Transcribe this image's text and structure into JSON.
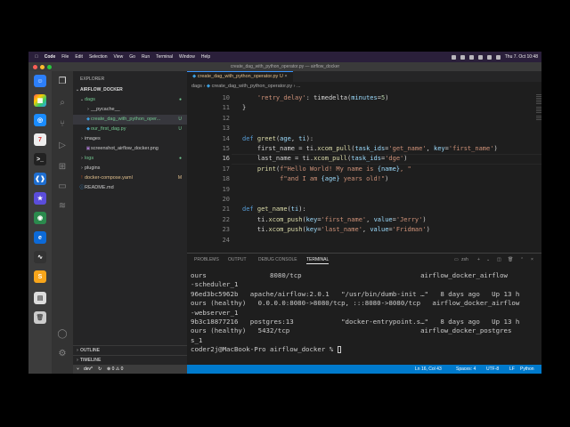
{
  "menubar": {
    "apple": "",
    "app": "Code",
    "items": [
      "File",
      "Edit",
      "Selection",
      "View",
      "Go",
      "Run",
      "Terminal",
      "Window",
      "Help"
    ],
    "clock": "Thu 7. Oct 10:48"
  },
  "window": {
    "title": "create_dag_with_python_operator.py — airflow_docker"
  },
  "sidebar": {
    "title": "EXPLORER",
    "root": "AIRFLOW_DOCKER",
    "items": [
      {
        "label": "dags",
        "type": "folder",
        "badge": "●",
        "badge_color": "#73c991"
      },
      {
        "label": "__pycache__",
        "type": "folder",
        "badge": ""
      },
      {
        "label": "create_dag_with_python_oper...",
        "type": "py",
        "badge": "U",
        "badge_color": "#73c991",
        "selected": true
      },
      {
        "label": "our_first_dag.py",
        "type": "py",
        "badge": "U",
        "badge_color": "#73c991"
      },
      {
        "label": "images",
        "type": "folder",
        "badge": ""
      },
      {
        "label": "screenshot_airflow_docker.png",
        "type": "img",
        "badge": ""
      },
      {
        "label": "logs",
        "type": "folder",
        "badge": "●",
        "badge_color": "#73c991"
      },
      {
        "label": "plugins",
        "type": "folder",
        "badge": ""
      },
      {
        "label": "docker-compose.yaml",
        "type": "yaml",
        "badge": "M",
        "badge_color": "#e2c08d"
      },
      {
        "label": "README.md",
        "type": "md",
        "badge": ""
      }
    ],
    "outline": "OUTLINE",
    "timeline": "TIMELINE"
  },
  "editor": {
    "tab": "create_dag_with_python_operator.py",
    "tab_badge": "U",
    "breadcrumb": [
      "dags",
      "create_dag_with_python_operator.py",
      "..."
    ],
    "current_line": 16,
    "lines": [
      {
        "n": "10",
        "t": [
          [
            "    ",
            ""
          ],
          [
            "'retry_delay'",
            "st"
          ],
          [
            ": timedelta(",
            ""
          ],
          [
            "minutes",
            "vr"
          ],
          [
            "=",
            ""
          ],
          [
            "5",
            "nm"
          ],
          [
            ")",
            ""
          ]
        ]
      },
      {
        "n": "11",
        "t": [
          [
            "}",
            ""
          ]
        ]
      },
      {
        "n": "12",
        "t": []
      },
      {
        "n": "13",
        "t": []
      },
      {
        "n": "14",
        "t": [
          [
            "def ",
            "kw"
          ],
          [
            "greet",
            "fn"
          ],
          [
            "(",
            ""
          ],
          [
            "age",
            "vr"
          ],
          [
            ", ",
            ""
          ],
          [
            "ti",
            "vr"
          ],
          [
            "):",
            ""
          ]
        ]
      },
      {
        "n": "15",
        "t": [
          [
            "    first_name = ti.",
            ""
          ],
          [
            "xcom_pull",
            "fn"
          ],
          [
            "(",
            ""
          ],
          [
            "task_ids",
            "vr"
          ],
          [
            "=",
            ""
          ],
          [
            "'get_name'",
            "st"
          ],
          [
            ", ",
            ""
          ],
          [
            "key",
            "vr"
          ],
          [
            "=",
            ""
          ],
          [
            "'first_name'",
            "st"
          ],
          [
            ")",
            ""
          ]
        ]
      },
      {
        "n": "16",
        "t": [
          [
            "    last_name = ti.",
            ""
          ],
          [
            "xcom_pull",
            "fn"
          ],
          [
            "(",
            ""
          ],
          [
            "task_ids",
            "vr"
          ],
          [
            "=",
            ""
          ],
          [
            "'dge'",
            "st"
          ],
          [
            ")",
            ""
          ]
        ]
      },
      {
        "n": "17",
        "t": [
          [
            "    ",
            ""
          ],
          [
            "print",
            "fn"
          ],
          [
            "(",
            ""
          ],
          [
            "f\"Hello World! My name is ",
            "st"
          ],
          [
            "{name}",
            "vr"
          ],
          [
            ", \"",
            "st"
          ]
        ]
      },
      {
        "n": "18",
        "t": [
          [
            "          ",
            ""
          ],
          [
            "f\"and I am ",
            "st"
          ],
          [
            "{age}",
            "vr"
          ],
          [
            " years old!\"",
            "st"
          ],
          [
            ")",
            ""
          ]
        ]
      },
      {
        "n": "19",
        "t": []
      },
      {
        "n": "20",
        "t": []
      },
      {
        "n": "21",
        "t": [
          [
            "def ",
            "kw"
          ],
          [
            "get_name",
            "fn"
          ],
          [
            "(",
            ""
          ],
          [
            "ti",
            "vr"
          ],
          [
            "):",
            ""
          ]
        ]
      },
      {
        "n": "22",
        "t": [
          [
            "    ti.",
            ""
          ],
          [
            "xcom_push",
            "fn"
          ],
          [
            "(",
            ""
          ],
          [
            "key",
            "vr"
          ],
          [
            "=",
            ""
          ],
          [
            "'first_name'",
            "st"
          ],
          [
            ", ",
            ""
          ],
          [
            "value",
            "vr"
          ],
          [
            "=",
            ""
          ],
          [
            "'Jerry'",
            "st"
          ],
          [
            ")",
            ""
          ]
        ]
      },
      {
        "n": "23",
        "t": [
          [
            "    ti.",
            ""
          ],
          [
            "xcom_push",
            "fn"
          ],
          [
            "(",
            ""
          ],
          [
            "key",
            "vr"
          ],
          [
            "=",
            ""
          ],
          [
            "'last_name'",
            "st"
          ],
          [
            ", ",
            ""
          ],
          [
            "value",
            "vr"
          ],
          [
            "=",
            ""
          ],
          [
            "'Fridman'",
            "st"
          ],
          [
            ")",
            ""
          ]
        ]
      },
      {
        "n": "24",
        "t": []
      }
    ]
  },
  "panel": {
    "tabs": [
      "PROBLEMS",
      "OUTPUT",
      "DEBUG CONSOLE",
      "TERMINAL"
    ],
    "active_tab": "TERMINAL",
    "shell": "zsh",
    "terminal": [
      "ours                8080/tcp                              airflow_docker_airflow",
      "-scheduler_1",
      "96ed3bc5962b   apache/airflow:2.0.1   \"/usr/bin/dumb-init …\"   8 days ago   Up 13 h",
      "ours (healthy)   0.0.0.0:8080->8080/tcp, :::8080->8080/tcp   airflow_docker_airflow",
      "-webserver_1",
      "9b3c18877216   postgres:13            \"docker-entrypoint.s…\"   8 days ago   Up 13 h",
      "ours (healthy)   5432/tcp                                 airflow_docker_postgres",
      "s_1"
    ],
    "prompt": "coder2j@MacBook-Pro airflow_docker % "
  },
  "status": {
    "branch": "dev*",
    "sync": "↻",
    "errors": "⊗ 0 ⚠ 0",
    "position": "Ln 16, Col 43",
    "spaces": "Spaces: 4",
    "encoding": "UTF-8",
    "eol": "LF",
    "language": "Python"
  },
  "colors": {
    "accent": "#007acc",
    "untracked": "#73c991",
    "modified": "#e2c08d"
  }
}
